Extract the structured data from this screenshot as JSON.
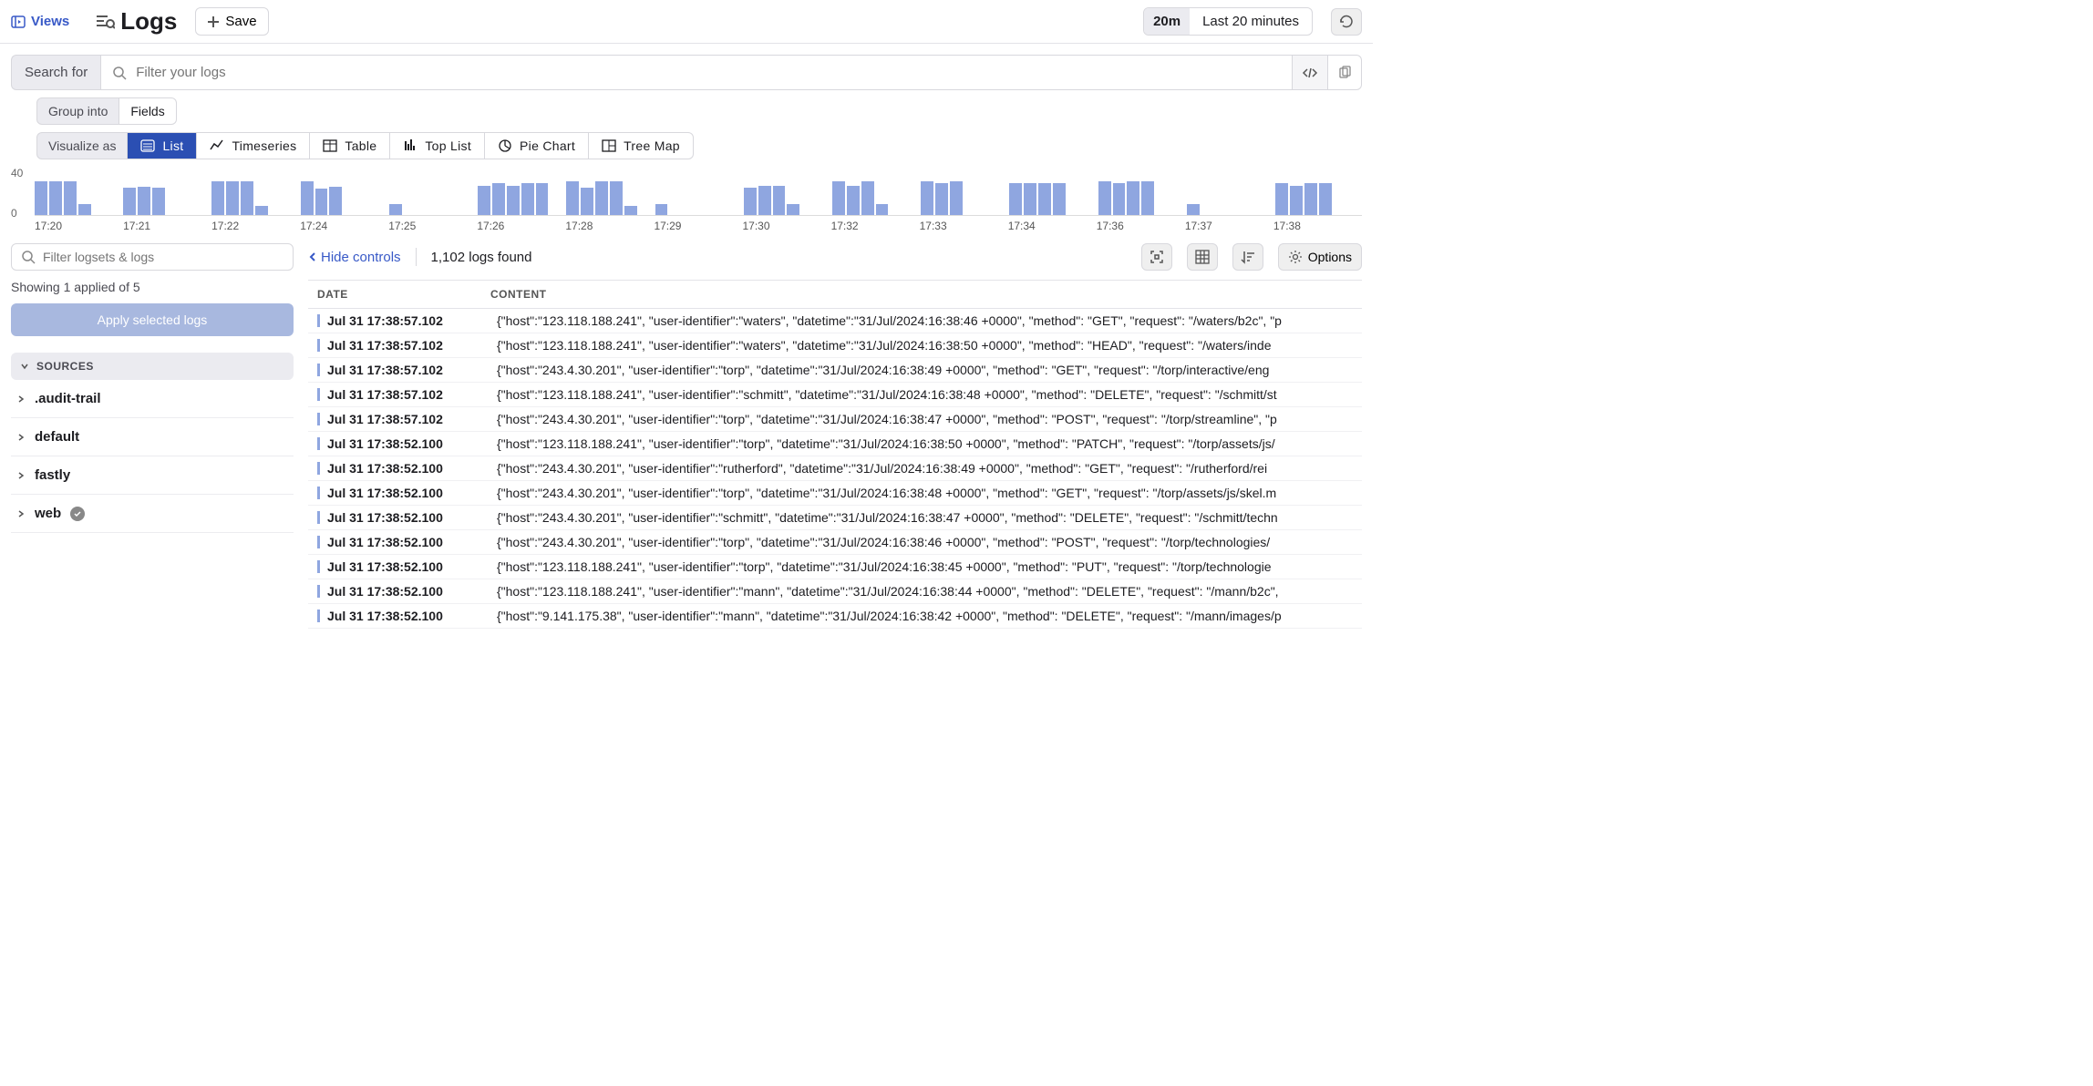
{
  "header": {
    "views": "Views",
    "title": "Logs",
    "save": "Save",
    "time_chip": "20m",
    "time_text": "Last 20 minutes"
  },
  "search": {
    "label": "Search for",
    "placeholder": "Filter your logs"
  },
  "group": {
    "label": "Group into",
    "fields": "Fields"
  },
  "visualize": {
    "label": "Visualize as",
    "tabs": [
      "List",
      "Timeseries",
      "Table",
      "Top List",
      "Pie Chart",
      "Tree Map"
    ]
  },
  "chart_data": {
    "type": "bar",
    "ylabel": "",
    "ylim": [
      0,
      40
    ],
    "yticks": [
      0,
      40
    ],
    "categories": [
      "17:20",
      "17:21",
      "17:22",
      "17:24",
      "17:25",
      "17:26",
      "17:28",
      "17:29",
      "17:30",
      "17:32",
      "17:33",
      "17:34",
      "17:36",
      "17:37",
      "17:38"
    ],
    "groups": [
      [
        30,
        30,
        30,
        10,
        0
      ],
      [
        24,
        25,
        24,
        0,
        0
      ],
      [
        30,
        30,
        30,
        8,
        0
      ],
      [
        30,
        23,
        25,
        0,
        0
      ],
      [
        10,
        0,
        0,
        0,
        0
      ],
      [
        26,
        28,
        26,
        28,
        28
      ],
      [
        30,
        24,
        30,
        30,
        8
      ],
      [
        10,
        0,
        0,
        0,
        0
      ],
      [
        24,
        26,
        26,
        10,
        0
      ],
      [
        30,
        26,
        30,
        10,
        0
      ],
      [
        30,
        28,
        30,
        0,
        0
      ],
      [
        28,
        28,
        28,
        28,
        0
      ],
      [
        30,
        28,
        30,
        30,
        0
      ],
      [
        10,
        0,
        0,
        0,
        0
      ],
      [
        28,
        26,
        28,
        28,
        0
      ]
    ]
  },
  "left": {
    "filter_placeholder": "Filter logsets & logs",
    "showing": "Showing 1 applied of 5",
    "apply": "Apply selected logs",
    "sources_label": "SOURCES",
    "sources": [
      {
        "name": ".audit-trail",
        "checked": false
      },
      {
        "name": "default",
        "checked": false
      },
      {
        "name": "fastly",
        "checked": false
      },
      {
        "name": "web",
        "checked": true
      }
    ]
  },
  "controls": {
    "hide": "Hide controls",
    "found": "1,102 logs found",
    "options": "Options"
  },
  "table": {
    "col_date": "DATE",
    "col_content": "CONTENT",
    "rows": [
      {
        "date": "Jul 31 17:38:57.102",
        "content": "{\"host\":\"123.118.188.241\", \"user-identifier\":\"waters\", \"datetime\":\"31/Jul/2024:16:38:46 +0000\", \"method\": \"GET\", \"request\": \"/waters/b2c\", \"p"
      },
      {
        "date": "Jul 31 17:38:57.102",
        "content": "{\"host\":\"123.118.188.241\", \"user-identifier\":\"waters\", \"datetime\":\"31/Jul/2024:16:38:50 +0000\", \"method\": \"HEAD\", \"request\": \"/waters/inde"
      },
      {
        "date": "Jul 31 17:38:57.102",
        "content": "{\"host\":\"243.4.30.201\", \"user-identifier\":\"torp\", \"datetime\":\"31/Jul/2024:16:38:49 +0000\", \"method\": \"GET\", \"request\": \"/torp/interactive/eng"
      },
      {
        "date": "Jul 31 17:38:57.102",
        "content": "{\"host\":\"123.118.188.241\", \"user-identifier\":\"schmitt\", \"datetime\":\"31/Jul/2024:16:38:48 +0000\", \"method\": \"DELETE\", \"request\": \"/schmitt/st"
      },
      {
        "date": "Jul 31 17:38:57.102",
        "content": "{\"host\":\"243.4.30.201\", \"user-identifier\":\"torp\", \"datetime\":\"31/Jul/2024:16:38:47 +0000\", \"method\": \"POST\", \"request\": \"/torp/streamline\", \"p"
      },
      {
        "date": "Jul 31 17:38:52.100",
        "content": "{\"host\":\"123.118.188.241\", \"user-identifier\":\"torp\", \"datetime\":\"31/Jul/2024:16:38:50 +0000\", \"method\": \"PATCH\", \"request\": \"/torp/assets/js/"
      },
      {
        "date": "Jul 31 17:38:52.100",
        "content": "{\"host\":\"243.4.30.201\", \"user-identifier\":\"rutherford\", \"datetime\":\"31/Jul/2024:16:38:49 +0000\", \"method\": \"GET\", \"request\": \"/rutherford/rei"
      },
      {
        "date": "Jul 31 17:38:52.100",
        "content": "{\"host\":\"243.4.30.201\", \"user-identifier\":\"torp\", \"datetime\":\"31/Jul/2024:16:38:48 +0000\", \"method\": \"GET\", \"request\": \"/torp/assets/js/skel.m"
      },
      {
        "date": "Jul 31 17:38:52.100",
        "content": "{\"host\":\"243.4.30.201\", \"user-identifier\":\"schmitt\", \"datetime\":\"31/Jul/2024:16:38:47 +0000\", \"method\": \"DELETE\", \"request\": \"/schmitt/techn"
      },
      {
        "date": "Jul 31 17:38:52.100",
        "content": "{\"host\":\"243.4.30.201\", \"user-identifier\":\"torp\", \"datetime\":\"31/Jul/2024:16:38:46 +0000\", \"method\": \"POST\", \"request\": \"/torp/technologies/"
      },
      {
        "date": "Jul 31 17:38:52.100",
        "content": "{\"host\":\"123.118.188.241\", \"user-identifier\":\"torp\", \"datetime\":\"31/Jul/2024:16:38:45 +0000\", \"method\": \"PUT\", \"request\": \"/torp/technologie"
      },
      {
        "date": "Jul 31 17:38:52.100",
        "content": "{\"host\":\"123.118.188.241\", \"user-identifier\":\"mann\", \"datetime\":\"31/Jul/2024:16:38:44 +0000\", \"method\": \"DELETE\", \"request\": \"/mann/b2c\","
      },
      {
        "date": "Jul 31 17:38:52.100",
        "content": "{\"host\":\"9.141.175.38\", \"user-identifier\":\"mann\", \"datetime\":\"31/Jul/2024:16:38:42 +0000\", \"method\": \"DELETE\", \"request\": \"/mann/images/p"
      }
    ]
  }
}
